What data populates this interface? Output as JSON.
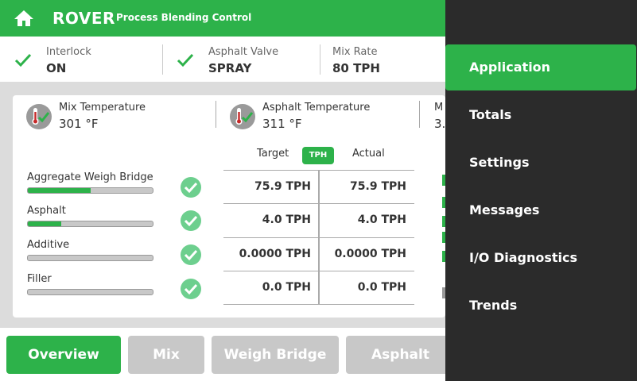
{
  "header": {
    "brand": "ROVER",
    "subtitle": "Process Blending Control"
  },
  "status": [
    {
      "label": "Interlock",
      "value": "ON"
    },
    {
      "label": "Asphalt Valve",
      "value": "SPRAY"
    },
    {
      "label": "Mix Rate",
      "value": "80 TPH"
    }
  ],
  "temps": [
    {
      "label": "Mix Temperature",
      "value": "301 °F"
    },
    {
      "label": "Asphalt Temperature",
      "value": "311 °F"
    },
    {
      "label": "M",
      "value": "3."
    }
  ],
  "table": {
    "target_header": "Target",
    "unit_badge": "TPH",
    "actual_header": "Actual",
    "rows": [
      {
        "label": "Aggregate Weigh Bridge",
        "progress": 0.5,
        "target": "75.9 TPH",
        "actual": "75.9 TPH"
      },
      {
        "label": "Asphalt",
        "progress": 0.27,
        "target": "4.0 TPH",
        "actual": "4.0 TPH"
      },
      {
        "label": "Additive",
        "progress": 0,
        "target": "0.0000 TPH",
        "actual": "0.0000 TPH"
      },
      {
        "label": "Filler",
        "progress": 0,
        "target": "0.0 TPH",
        "actual": "0.0 TPH"
      }
    ]
  },
  "tabs": [
    "Overview",
    "Mix",
    "Weigh Bridge",
    "Asphalt"
  ],
  "menu": [
    "Application",
    "Totals",
    "Settings",
    "Messages",
    "I/O Diagnostics",
    "Trends"
  ],
  "colors": {
    "accent": "#2db24a",
    "menu_bg": "#2b2b2b"
  }
}
